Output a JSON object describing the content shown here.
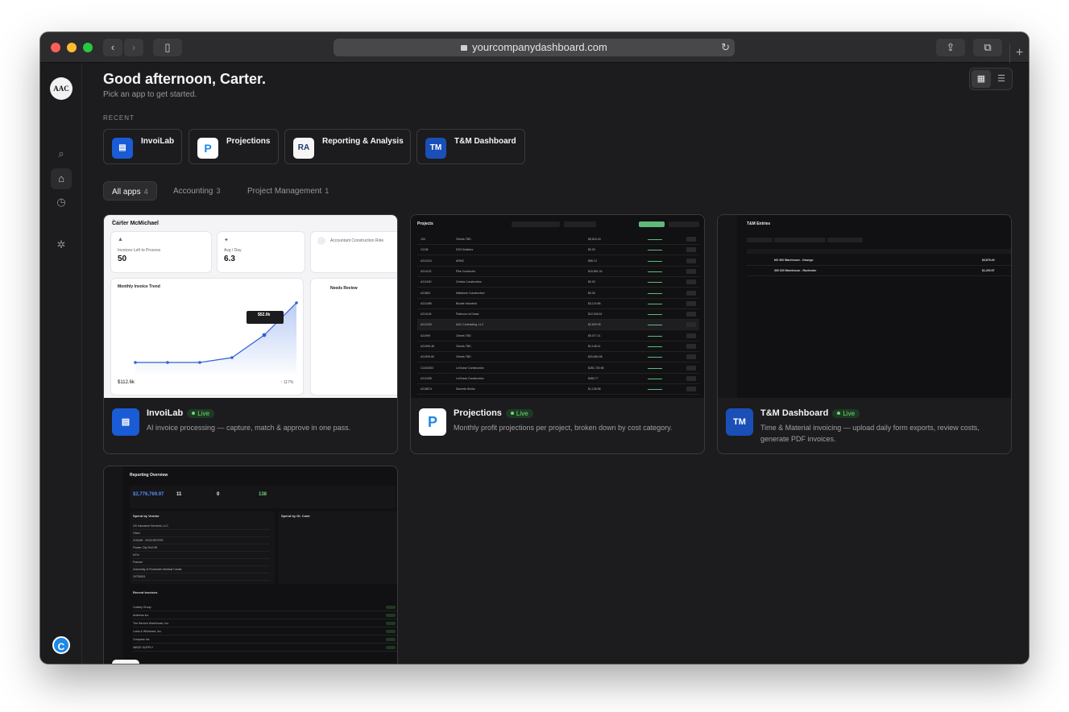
{
  "browser": {
    "url": "yourcompanydashboard.com",
    "back_icon": "chevron-left-icon",
    "forward_icon": "chevron-right-icon",
    "sidebar_icon": "sidebar-icon",
    "share_icon": "share-icon",
    "tabs_icon": "tabs-icon",
    "new_tab": "+"
  },
  "sidebar": {
    "logo_text": "AAC",
    "items": [
      {
        "name": "search",
        "icon": "search-icon",
        "glyph": "⌕"
      },
      {
        "name": "home",
        "icon": "home-icon",
        "glyph": "⌂"
      },
      {
        "name": "history",
        "icon": "clock-icon",
        "glyph": "◷"
      },
      {
        "name": "settings",
        "icon": "gear-icon",
        "glyph": "✲"
      }
    ],
    "avatar_text": "C"
  },
  "header": {
    "greeting": "Good afternoon, Carter.",
    "subtitle": "Pick an app to get started.",
    "grid_view_icon": "grid-icon",
    "list_view_icon": "list-icon"
  },
  "recent": {
    "label": "RECENT",
    "items": [
      {
        "label": "InvoiLab",
        "icon_text": "▤"
      },
      {
        "label": "Projections",
        "icon_text": "P"
      },
      {
        "label": "Reporting & Analysis",
        "icon_text": "RA"
      },
      {
        "label": "T&M Dashboard",
        "icon_text": "TM"
      }
    ]
  },
  "filters": [
    {
      "label": "All apps",
      "count": "4"
    },
    {
      "label": "Accounting",
      "count": "3"
    },
    {
      "label": "Project Management",
      "count": "1"
    }
  ],
  "apps": [
    {
      "title": "InvoiLab",
      "status": "Live",
      "description": "AI invoice processing — capture, match & approve in one pass.",
      "icon_text": "▤"
    },
    {
      "title": "Projections",
      "status": "Live",
      "description": "Monthly profit projections per project, broken down by cost category.",
      "icon_text": "P"
    },
    {
      "title": "T&M Dashboard",
      "status": "Live",
      "description": "Time & Material invoicing — upload daily form exports, review costs, generate PDF invoices.",
      "icon_text": "TM"
    },
    {
      "title": "Reporting & Analysis",
      "status": "",
      "description": "",
      "icon_text": "RA"
    }
  ],
  "previews": {
    "invoilab": {
      "owner": "Carter McMichael",
      "stat1_label": "Invoices Left to Process",
      "stat1_value": "50",
      "stat2_label": "Avg / Day",
      "stat2_value": "6.3",
      "stat3_label": "Accountant Construction Role",
      "chart_title": "Monthly Invoice Trend",
      "alerts_title": "Needs Review",
      "tooltip_value": "$52.0k",
      "total_value": "$112.6k",
      "growth": "↑ 117%"
    },
    "projections": {
      "title": "Projects",
      "rows": [
        {
          "id": "100",
          "client": "Clients TBD",
          "value": "$5,616.18"
        },
        {
          "id": "21138",
          "client": "DSG Builders",
          "value": "$0.00"
        },
        {
          "id": "A211224",
          "client": "ARMC",
          "value": "$56.13"
        },
        {
          "id": "A211122",
          "client": "Pike Conductor",
          "value": "$19,861.34"
        },
        {
          "id": "A211150",
          "client": "Christa Construction",
          "value": "$0.00"
        },
        {
          "id": "A21854",
          "client": "Milestone Construction",
          "value": "$0.00"
        },
        {
          "id": "A211485",
          "client": "Buckle Industrial",
          "value": "$3,124.86"
        },
        {
          "id": "A211126",
          "client": "Platinum LeChase",
          "value": "$12,006.51"
        },
        {
          "id": "A211233",
          "client": "AAC Contracting, LLC",
          "value": "$2,609.95"
        },
        {
          "id": "A21999",
          "client": "Clients TBD",
          "value": "$9,077.41"
        },
        {
          "id": "A21999-46",
          "client": "Clients TBD",
          "value": "$1,148.41"
        },
        {
          "id": "A21999-50",
          "client": "Clients TBD",
          "value": "$20,684.98"
        },
        {
          "id": "C1420202",
          "client": "LeChase Construction",
          "value": "$281,730.98"
        },
        {
          "id": "A211008",
          "client": "LeChase Construction",
          "value": "$480.77"
        },
        {
          "id": "A218874",
          "client": "Discrete Works",
          "value": "$1,136.58"
        }
      ]
    },
    "tm": {
      "title": "T&M Entries",
      "rows": [
        {
          "job": "NO 300 Warehouse - Oswego",
          "amount": "$3,676.40"
        },
        {
          "job": "300 300 Warehouse - Rochester",
          "amount": "$1,200.57"
        }
      ]
    },
    "reporting": {
      "title": "Reporting Overview",
      "total": "$2,776,769.97",
      "flagged": "11",
      "pending": "0",
      "line_items": "138",
      "vendor_title": "Spend by Vendor",
      "gl_title": "Spend by GL Code",
      "recent_title": "Recent Invoices",
      "vendors": [
        "US Insurance Services, LLC",
        "Ohed",
        "XONAR - ROCHESTER",
        "Flower City Roll Off",
        "InTrx",
        "Frazure",
        "University of Rochester Medical Center",
        "20750001"
      ],
      "invoices": [
        "Cosbey Group",
        "Andrews Inc.",
        "The Service Warehouse, Inc.",
        "Lotus & Windrows, Inc.",
        "Compass Inc.",
        "WBOE SUPPLY"
      ]
    }
  }
}
